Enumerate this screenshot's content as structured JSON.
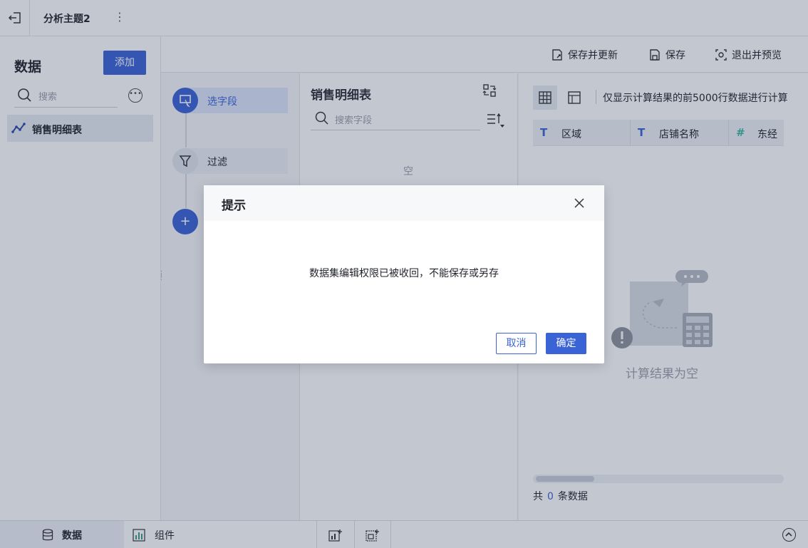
{
  "topbar": {
    "title": "分析主题2",
    "more_icon": "more-vertical-icon",
    "back_icon": "exit-icon"
  },
  "left_panel": {
    "title": "数据",
    "add_label": "添加",
    "search_placeholder": "搜索",
    "dataset_item": "销售明细表"
  },
  "toolbar": {
    "save_update": "保存并更新",
    "save": "保存",
    "exit_preview": "退出并预览"
  },
  "steps": {
    "select_fields": "选字段",
    "filter": "过滤",
    "add_icon": "+"
  },
  "fields_panel": {
    "title": "销售明细表",
    "search_placeholder": "搜索字段",
    "empty": "空"
  },
  "preview": {
    "note": "仅显示计算结果的前5000行数据进行计算",
    "columns": [
      {
        "type_icon": "T",
        "label": "区域"
      },
      {
        "type_icon": "T",
        "label": "店铺名称"
      },
      {
        "type_icon": "#",
        "label": "东经"
      }
    ],
    "empty_text": "计算结果为空",
    "count_prefix": "共",
    "count_value": "0",
    "count_suffix": "条数据"
  },
  "bottombar": {
    "data_tab": "数据",
    "component_tab": "组件"
  },
  "modal": {
    "title": "提示",
    "message": "数据集编辑权限已被收回，不能保存或另存",
    "cancel": "取消",
    "ok": "确定"
  },
  "colors": {
    "accent": "#3a63d6",
    "muted_text": "#9aa1ab"
  }
}
